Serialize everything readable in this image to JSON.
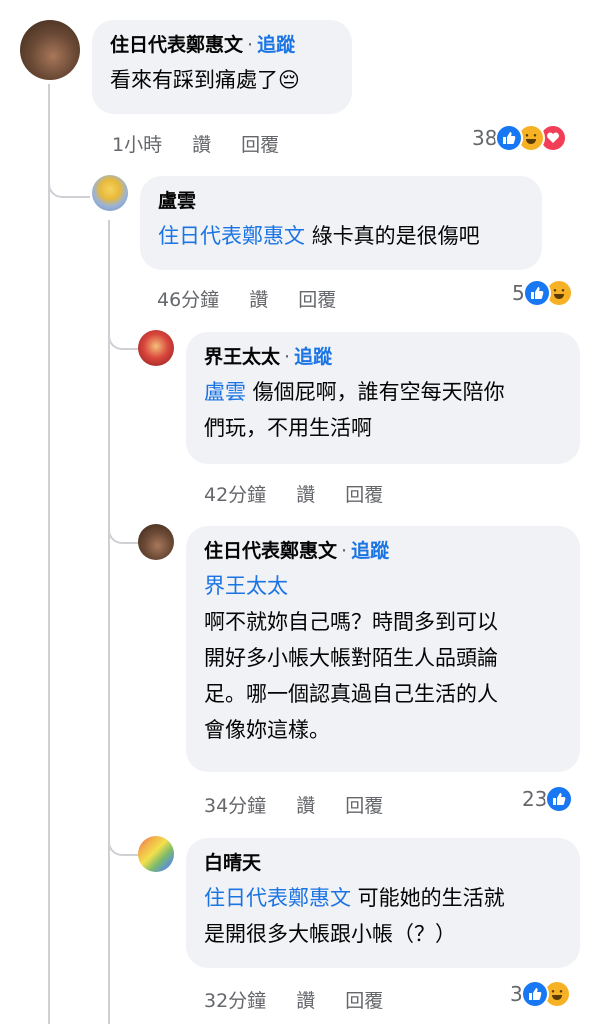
{
  "comments": [
    {
      "author": "住日代表鄭惠文",
      "follow_label": "追蹤",
      "text": "看來有踩到痛處了😔",
      "mention": "",
      "time": "1小時",
      "like_label": "讚",
      "reply_label": "回覆",
      "reaction_count": "38",
      "reactions": [
        "like-icon",
        "haha-icon",
        "love-icon"
      ],
      "avatar_color": "#6b4a36"
    },
    {
      "author": "盧雲",
      "follow_label": "",
      "mention": "住日代表鄭惠文",
      "text": " 綠卡真的是很傷吧",
      "time": "46分鐘",
      "like_label": "讚",
      "reply_label": "回覆",
      "reaction_count": "5",
      "reactions": [
        "like-icon",
        "haha-icon"
      ],
      "avatar_color": "#9bb3d6"
    },
    {
      "author": "界王太太",
      "follow_label": "追蹤",
      "mention": "盧雲",
      "text_line1": " 傷個屁啊，誰有空每天陪你",
      "text_line2": "們玩，不用生活啊",
      "time": "42分鐘",
      "like_label": "讚",
      "reply_label": "回覆",
      "reaction_count": "",
      "reactions": [],
      "avatar_color": "#c0272d"
    },
    {
      "author": "住日代表鄭惠文",
      "follow_label": "追蹤",
      "mention": "界王太太",
      "text_line1": "啊不就妳自己嗎？時間多到可以",
      "text_line2": "開好多小帳大帳對陌生人品頭論",
      "text_line3": "足。哪一個認真過自己生活的人",
      "text_line4": "會像妳這樣。",
      "time": "34分鐘",
      "like_label": "讚",
      "reply_label": "回覆",
      "reaction_count": "23",
      "reactions": [
        "like-icon"
      ],
      "avatar_color": "#6b4a36"
    },
    {
      "author": "白晴天",
      "follow_label": "",
      "mention": "住日代表鄭惠文",
      "text_line1": " 可能她的生活就",
      "text_line2": "是開很多大帳跟小帳（？）",
      "time": "32分鐘",
      "like_label": "讚",
      "reply_label": "回覆",
      "reaction_count": "3",
      "reactions": [
        "like-icon",
        "haha-icon"
      ],
      "avatar_color": "#7dbb6a"
    }
  ],
  "colors": {
    "accent": "#1b74e4",
    "bubble": "#f0f2f5",
    "meta": "#65676b",
    "like": "#1877f2",
    "haha": "#f7b125",
    "love": "#f33e58"
  }
}
